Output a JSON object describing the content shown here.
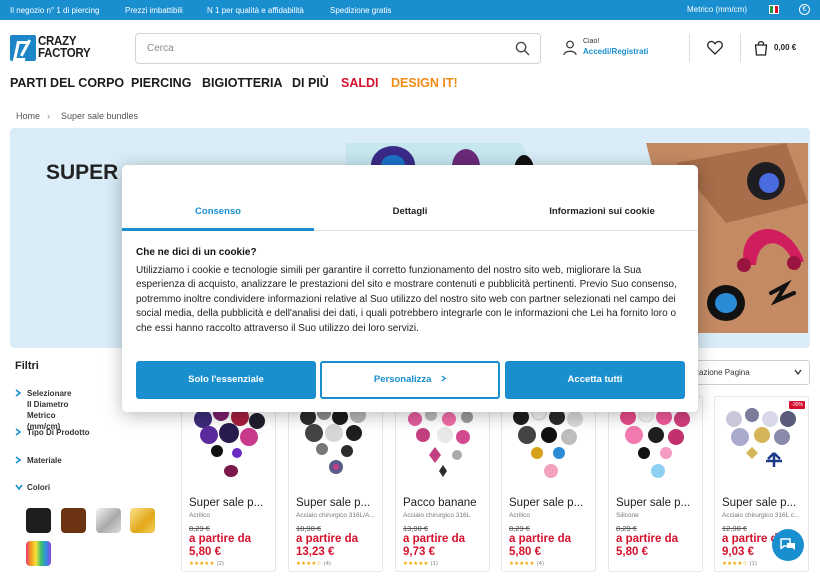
{
  "topbar": {
    "messages": [
      "Il negozio n° 1 di piercing",
      "Prezzi imbattibili",
      "N 1 per qualità e affidabilità",
      "Spedizione gratis"
    ],
    "metric": "Metrico (mm/cm)",
    "currency_symbol": "€"
  },
  "header": {
    "logo_line1": "CRAZY",
    "logo_line2": "FACTORY",
    "search_placeholder": "Cerca",
    "greeting": "Ciao!",
    "login_label": "Accedi/Registrati",
    "cart_total": "0,00 €"
  },
  "nav": {
    "items": [
      {
        "label": "PARTI DEL CORPO",
        "color": "#1b1b1b"
      },
      {
        "label": "PIERCING",
        "color": "#1b1b1b"
      },
      {
        "label": "BIGIOTTERIA",
        "color": "#1b1b1b"
      },
      {
        "label": "DI PIÙ",
        "color": "#1b1b1b"
      },
      {
        "label": "SALDI",
        "color": "#d5112d"
      },
      {
        "label": "DESIGN IT!",
        "color": "#f08c14"
      }
    ]
  },
  "breadcrumb": {
    "home": "Home",
    "separator": "›",
    "current": "Super sale bundles"
  },
  "banner": {
    "title_visible": "SUPER"
  },
  "filters": {
    "title": "Filtri",
    "items": [
      {
        "label": "Selezionare Il Diametro\nMetrico (mm/cm)",
        "expanded": false
      },
      {
        "label": "Tipo Di Prodotto",
        "expanded": false
      },
      {
        "label": "Materiale",
        "expanded": false
      },
      {
        "label": "Colori",
        "expanded": true
      }
    ],
    "color_swatches": [
      "#1e1e1e",
      "#6b3311",
      "silver-gradient",
      "gold-gradient",
      "rainbow-gradient"
    ]
  },
  "sort": {
    "value": "zzazione Pagina"
  },
  "products": [
    {
      "name": "Super sale p...",
      "material": "Acrilico",
      "old_price": "8,29 €",
      "from_label": "a partire da",
      "price": "5,80 €",
      "rating": 5,
      "reviews": "(2)",
      "badge": ""
    },
    {
      "name": "Super sale p...",
      "material": "Acciaio chirurgico 316L/A...",
      "old_price": "18,90 €",
      "from_label": "a partire da",
      "price": "13,23 €",
      "rating": 4,
      "reviews": "(4)",
      "badge": ""
    },
    {
      "name": "Pacco banane",
      "material": "Acciaio chirurgico 316L",
      "old_price": "13,90 €",
      "from_label": "a partire da",
      "price": "9,73 €",
      "rating": 5,
      "reviews": "(1)",
      "badge": ""
    },
    {
      "name": "Super sale p...",
      "material": "Acrilico",
      "old_price": "8,29 €",
      "from_label": "a partire da",
      "price": "5,80 €",
      "rating": 5,
      "reviews": "(4)",
      "badge": ""
    },
    {
      "name": "Super sale p...",
      "material": "Silicone",
      "old_price": "8,29 €",
      "from_label": "a partire da",
      "price": "5,80 €",
      "rating": 0,
      "reviews": "",
      "badge": ""
    },
    {
      "name": "Super sale p...",
      "material": "Acciaio chirurgico 316L c...",
      "old_price": "12,90 €",
      "from_label": "a partire da",
      "price": "9,03 €",
      "rating": 4,
      "reviews": "(1)",
      "badge": "-30%"
    }
  ],
  "cookie_modal": {
    "tabs": [
      "Consenso",
      "Dettagli",
      "Informazioni sui cookie"
    ],
    "active_tab": 0,
    "title": "Che ne dici di un cookie?",
    "text": "Utilizziamo i cookie e tecnologie simili per garantire il corretto funzionamento del nostro sito web, migliorare la Sua esperienza di acquisto, analizzare le prestazioni del sito e mostrare contenuti e pubblicità pertinenti. Previo Suo consenso, potremmo inoltre condividere informazioni relative al Suo utilizzo del nostro sito web con partner selezionati nel campo dei social media, della pubblicità e dell'analisi dei dati, i quali potrebbero integrarle con le informazioni che Lei ha fornito loro o che essi hanno raccolto attraverso il Suo utilizzo dei loro servizi.",
    "buttons": {
      "essential": "Solo l'essenziale",
      "customize": "Personalizza",
      "accept_all": "Accetta tutti"
    }
  },
  "colors": {
    "accent": "#1a8fd0",
    "sale_red": "#d5112d",
    "design_orange": "#f08c14",
    "star": "#f0a500"
  }
}
